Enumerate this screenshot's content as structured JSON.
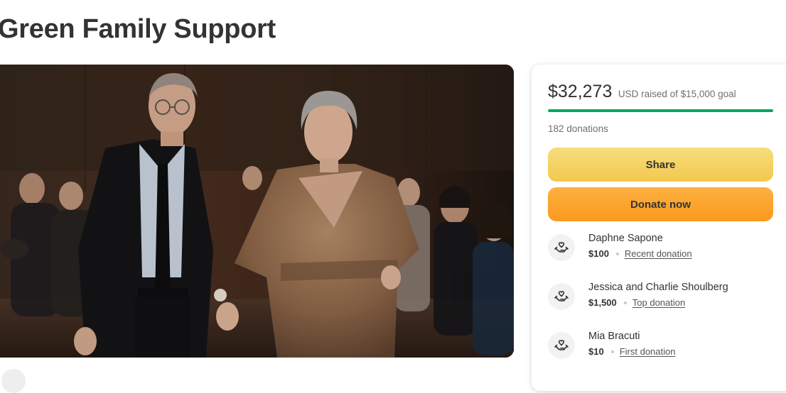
{
  "page": {
    "title": "Green Family Support"
  },
  "hero": {
    "icon": "fundraiser-photo"
  },
  "card": {
    "raised_amount": "$32,273",
    "raised_text": "USD raised of $15,000 goal",
    "progress_fraction": 1.0,
    "donation_count": "182 donations",
    "share_label": "Share",
    "donate_label": "Donate now",
    "donors": [
      {
        "name": "Daphne Sapone",
        "amount": "$100",
        "label": "Recent donation",
        "icon": "heart-hand-icon"
      },
      {
        "name": "Jessica and Charlie Shoulberg",
        "amount": "$1,500",
        "label": "Top donation",
        "icon": "heart-hand-icon"
      },
      {
        "name": "Mia Bracuti",
        "amount": "$10",
        "label": "First donation",
        "icon": "heart-hand-icon"
      }
    ]
  },
  "colors": {
    "progress": "#02a95c",
    "share_button": "#f3c84e",
    "donate_button": "#f99a1e",
    "text": "#333333"
  }
}
